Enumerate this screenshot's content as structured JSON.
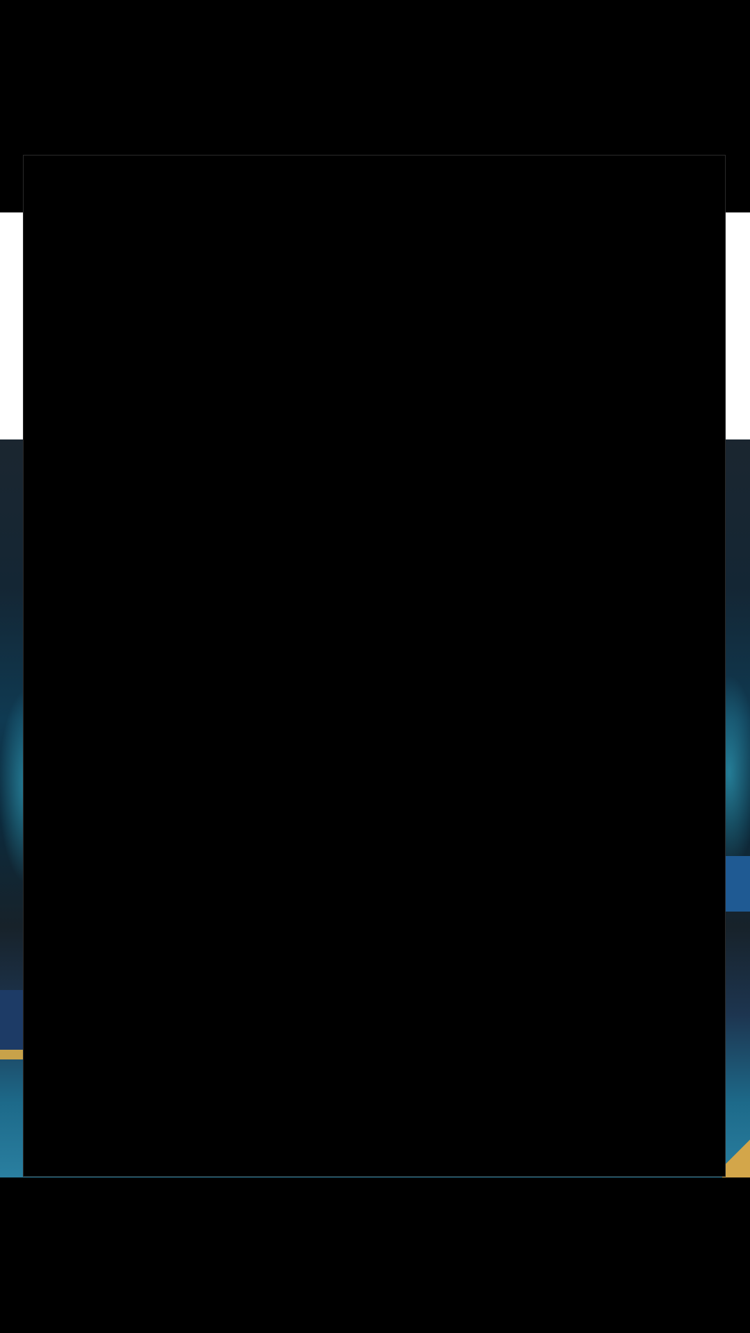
{
  "screen": {
    "background_color": "#000000",
    "overlay_color": "#000000",
    "band_color": "#ffffff",
    "accent_colors": [
      "#3cc8e6",
      "#1d6a8a",
      "#c8a24a"
    ]
  }
}
